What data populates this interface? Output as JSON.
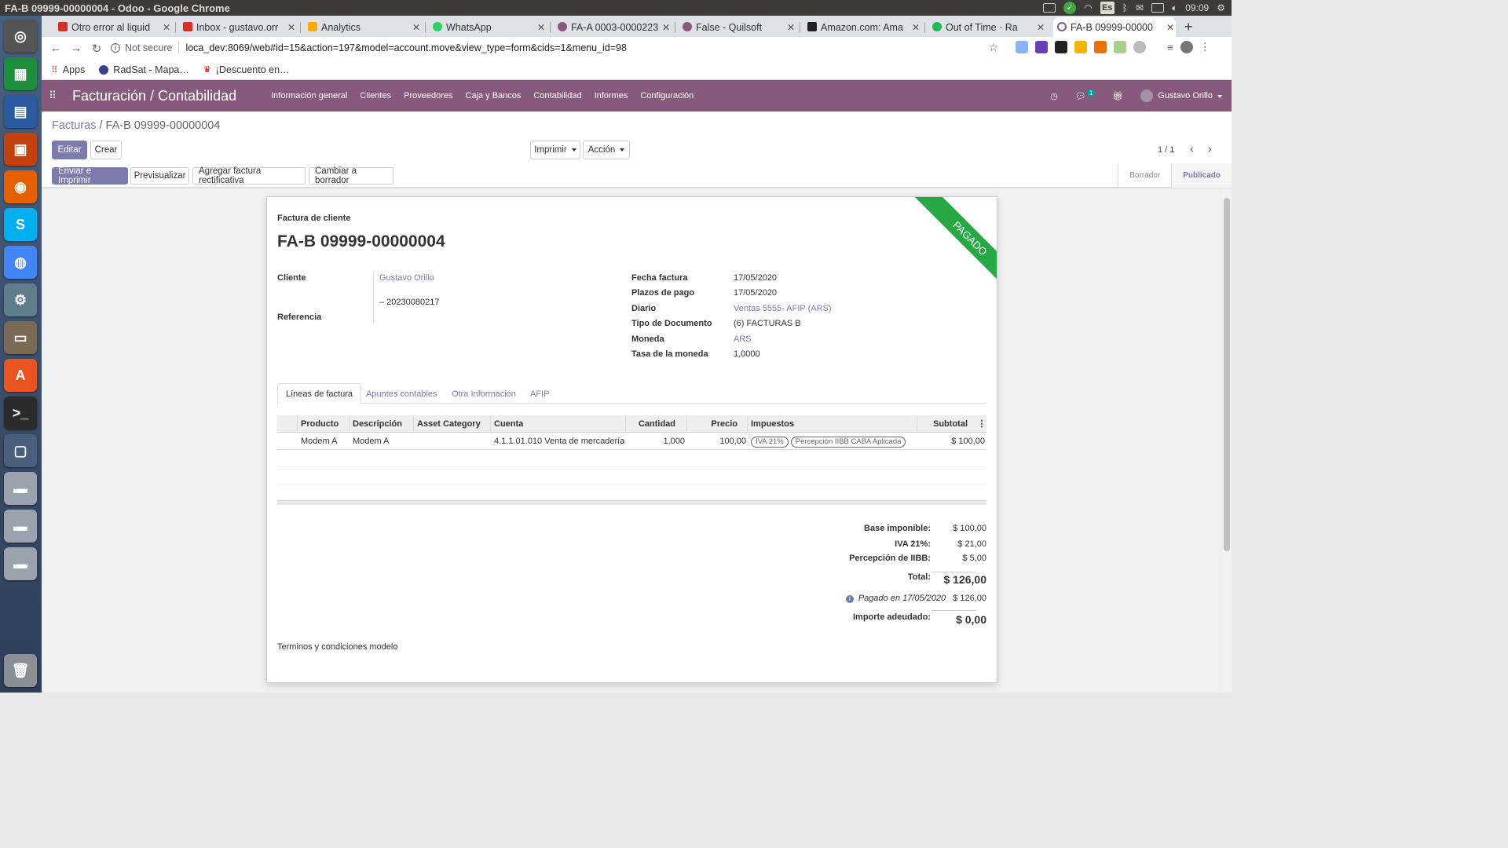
{
  "os": {
    "title": "FA-B 09999-00000004 - Odoo - Google Chrome",
    "lang": "Es",
    "time": "09:09"
  },
  "tabs": [
    {
      "title": "Otro error al liquid",
      "fav_color": "#d93025"
    },
    {
      "title": "Inbox - gustavo.orr",
      "fav_color": "#d93025"
    },
    {
      "title": "Analytics",
      "fav_color": "#f9ab00"
    },
    {
      "title": "WhatsApp",
      "fav_color": "#25d366"
    },
    {
      "title": "FA-A 0003-0000223",
      "fav_color": "#875a7b"
    },
    {
      "title": "False - Quilsoft",
      "fav_color": "#875a7b"
    },
    {
      "title": "Amazon.com: Ama",
      "fav_color": "#222"
    },
    {
      "title": "Out of Time · Ra",
      "fav_color": "#1db954"
    },
    {
      "title": "FA-B 09999-00000",
      "fav_color": "#875a7b"
    }
  ],
  "toolbar": {
    "security": "Not secure",
    "url": "loca_dev:8069/web#id=15&action=197&model=account.move&view_type=form&cids=1&menu_id=98"
  },
  "bookmarks": [
    "Apps",
    "RadSat - Mapa…",
    "¡Descuento en…"
  ],
  "odoo": {
    "app_name": "Facturación / Contabilidad",
    "menu": [
      "Información general",
      "Clientes",
      "Proveedores",
      "Caja y Bancos",
      "Contabilidad",
      "Informes",
      "Configuración"
    ],
    "chat_count": "1",
    "user": "Gustavo Orillo"
  },
  "control": {
    "breadcrumb_parent": "Facturas",
    "breadcrumb_sep": "/",
    "breadcrumb_current": "FA-B 09999-00000004",
    "edit": "Editar",
    "create": "Crear",
    "print": "Imprimir",
    "action": "Acción",
    "pager": "1 / 1"
  },
  "statusbar": {
    "buttons": [
      "Enviar e Imprimir",
      "Previsualizar",
      "Agregar factura rectificativa",
      "Cambiar a borrador"
    ],
    "states": [
      "Borrador",
      "Publicado"
    ]
  },
  "invoice": {
    "ribbon": "PAGADO",
    "doc_type": "Factura de cliente",
    "name": "FA-B 09999-00000004",
    "left_fields": {
      "cliente_label": "Cliente",
      "cliente": "Gustavo Orillo",
      "vat": "– 20230080217",
      "referencia_label": "Referencia"
    },
    "right_fields": [
      {
        "label": "Fecha factura",
        "value": "17/05/2020"
      },
      {
        "label": "Plazos de pago",
        "value": "17/05/2020"
      },
      {
        "label": "Diario",
        "value": "Ventas 5555- AFIP (ARS)"
      },
      {
        "label": "Tipo de Documento",
        "value": "(6) FACTURAS B"
      },
      {
        "label": "Moneda",
        "value": "ARS"
      },
      {
        "label": "Tasa de la moneda",
        "value": "1,0000"
      }
    ],
    "notebook_tabs": [
      "Líneas de factura",
      "Apuntes contables",
      "Otra Información",
      "AFIP"
    ],
    "columns": [
      "Producto",
      "Descripción",
      "Asset Category",
      "Cuenta",
      "Cantidad",
      "Precio",
      "Impuestos",
      "Subtotal"
    ],
    "line": {
      "producto": "Modem A",
      "descripcion": "Modem A",
      "asset_category": "",
      "cuenta": "4.1.1.01.010 Venta de mercadería",
      "cantidad": "1,000",
      "precio": "100,00",
      "taxes": [
        "IVA 21%",
        "Percepción IIBB CABA Aplicada"
      ],
      "subtotal": "$ 100,00"
    },
    "totals": {
      "base_label": "Base imponible:",
      "base": "$ 100,00",
      "iva_label": "IVA 21%:",
      "iva": "$ 21,00",
      "iibb_label": "Percepción de IIBB:",
      "iibb": "$ 5,00",
      "total_label": "Total:",
      "total": "$ 126,00",
      "paid_label": "Pagado en 17/05/2020",
      "paid": "$ 126,00",
      "due_label": "Importe adeudado:",
      "due": "$ 0,00"
    },
    "terms": "Terminos y condiciones modelo"
  }
}
